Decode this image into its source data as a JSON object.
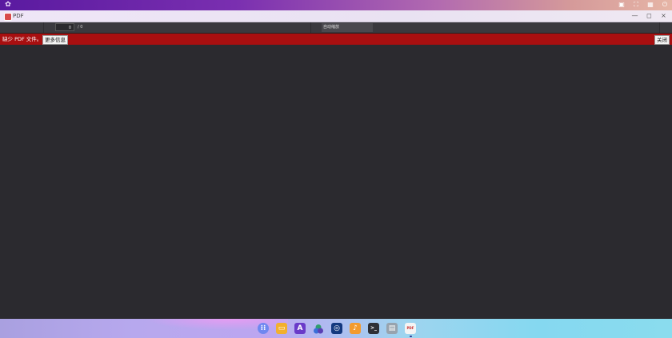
{
  "system_bar": {
    "logo_icon": "os-logo-icon",
    "tray": [
      "gift-icon",
      "fullscreen-icon",
      "grid-icon",
      "power-icon"
    ]
  },
  "window": {
    "title": "PDF",
    "controls": {
      "minimize": "—",
      "maximize": "◻",
      "close": "×"
    }
  },
  "toolbar": {
    "page_value": "0",
    "page_total": "/ 0",
    "zoom_label": "自动缩放"
  },
  "error_bar": {
    "message": "缺少 PDF 文件。",
    "more_info_label": "更多信息",
    "close_label": "关闭",
    "background": "#a80f10"
  },
  "dock": {
    "items": [
      {
        "name": "launcher",
        "glyph": "⁝⁝"
      },
      {
        "name": "files",
        "glyph": "▭"
      },
      {
        "name": "app-store",
        "glyph": "A"
      },
      {
        "name": "theme-colors",
        "glyph": ""
      },
      {
        "name": "browser",
        "glyph": "◎"
      },
      {
        "name": "voice-assistant",
        "glyph": "♪"
      },
      {
        "name": "terminal",
        "glyph": ">_"
      },
      {
        "name": "trash",
        "glyph": "▤"
      },
      {
        "name": "pdf-viewer",
        "glyph": "PDF"
      }
    ]
  }
}
